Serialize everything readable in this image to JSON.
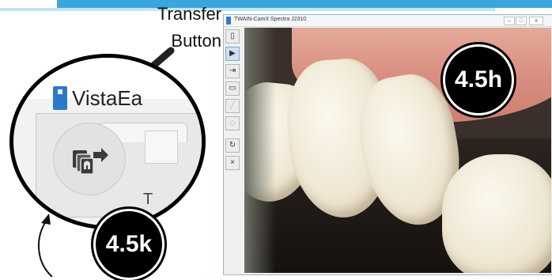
{
  "annotation": {
    "transfer_label": "Transfer",
    "button_label": "Button"
  },
  "zoom": {
    "app_title_fragment": "VistaEa",
    "footer_fragment": "T"
  },
  "badges": {
    "k": "4.5k",
    "h": "4.5h"
  },
  "window": {
    "title": "TWAIN-CamX Spectra J2310",
    "minimize_glyph": "–",
    "maximize_glyph": "□",
    "close_glyph": "x"
  },
  "toolbar": {
    "items": [
      {
        "name": "device-icon",
        "glyph": "▯",
        "state": "normal"
      },
      {
        "name": "play-icon",
        "glyph": "▶",
        "state": "active"
      },
      {
        "name": "transfer-icon",
        "glyph": "⇥",
        "state": "normal"
      },
      {
        "name": "monitor-icon",
        "glyph": "▭",
        "state": "normal"
      },
      {
        "name": "draw-icon",
        "glyph": "╱",
        "state": "disabled"
      },
      {
        "name": "erase-icon",
        "glyph": "◇",
        "state": "disabled"
      },
      {
        "name": "rotate-icon",
        "glyph": "↻",
        "state": "normal"
      },
      {
        "name": "close-icon",
        "glyph": "×",
        "state": "normal"
      }
    ]
  },
  "colors": {
    "accent_bar": "#3aa6db",
    "badge_bg": "#000000",
    "window_frame": "#9fb3c8"
  }
}
